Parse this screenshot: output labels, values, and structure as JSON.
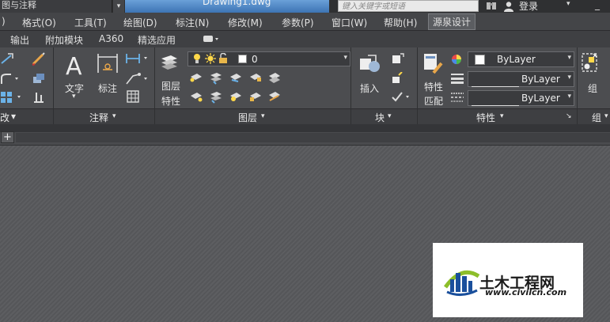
{
  "titlebar": {
    "workspace": "图与注释",
    "document_title": "Drawing1.dwg",
    "search_placeholder": "键入关键字或短语",
    "signin": "登录"
  },
  "menubar": {
    "items": [
      "格式(O)",
      "工具(T)",
      "绘图(D)",
      "标注(N)",
      "修改(M)",
      "参数(P)",
      "窗口(W)",
      "帮助(H)",
      "源泉设计"
    ],
    "first_partial": ")"
  },
  "tabs": [
    "输出",
    "附加模块",
    "A360",
    "精选应用"
  ],
  "ribbon": {
    "annotation": {
      "text_label": "文字",
      "dim_label": "标注",
      "title": "注释"
    },
    "layers": {
      "props_label_line1": "图层",
      "props_label_line2": "特性",
      "current_layer": "0",
      "title": "图层"
    },
    "block": {
      "insert_label": "插入",
      "title": "块"
    },
    "properties": {
      "match_label_line1": "特性",
      "match_label_line2": "匹配",
      "color": "ByLayer",
      "linetype": "ByLayer",
      "lineweight": "ByLayer",
      "title": "特性"
    },
    "groups": {
      "group_label": "组",
      "title": "组"
    },
    "left_partial_title": "改"
  },
  "watermark": {
    "title": "土木工程网",
    "url": "www.civilcn.com"
  },
  "colors": {
    "accent_blue": "#3d74b4",
    "ribbon_bg": "#4c4d50",
    "canvas_bg": "#5a5b5d"
  }
}
